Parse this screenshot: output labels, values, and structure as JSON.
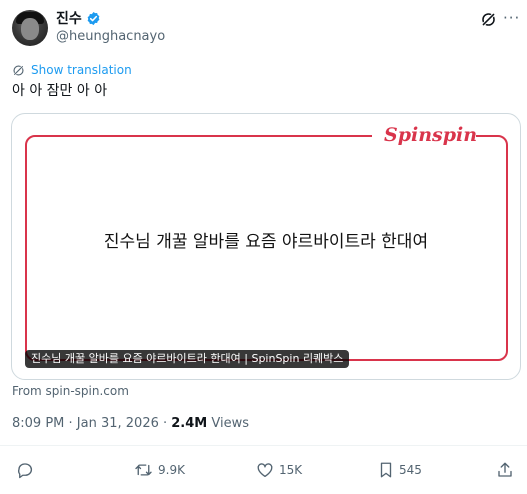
{
  "author": {
    "name": "진수",
    "handle": "@heunghacnayo"
  },
  "tweet": {
    "show_translation": "Show translation",
    "text": "아 아 잠만 아 아"
  },
  "card": {
    "logo_text": "Spinspin",
    "headline": "진수님 개꿀 알바를 요즘 야르바이트라 한대여",
    "caption": "진수님 개꿀 알바를 요즘 야르바이트라 한대여 | SpinSpin 리퀘박스",
    "source": "From spin-spin.com"
  },
  "meta": {
    "time": "8:09 PM",
    "separator": " · ",
    "date": "Jan 31, 2026",
    "views_count": "2.4M",
    "views_label": "Views"
  },
  "actions": {
    "retweets": "9.9K",
    "likes": "15K",
    "bookmarks": "545"
  },
  "colors": {
    "accent": "#1d9bf0",
    "card_brand": "#d9344b"
  },
  "icons": [
    "verified-badge-icon",
    "grok-icon",
    "more-icon",
    "translate-icon",
    "reply-icon",
    "retweet-icon",
    "like-icon",
    "bookmark-icon",
    "share-icon"
  ]
}
